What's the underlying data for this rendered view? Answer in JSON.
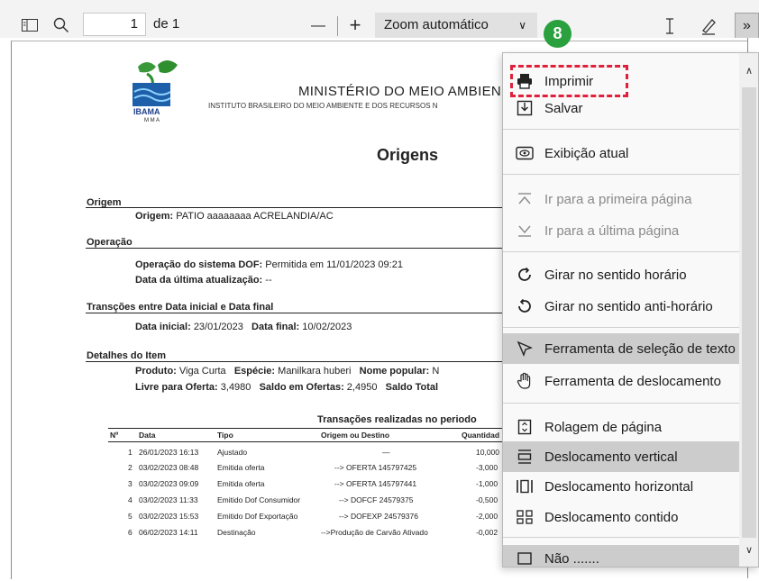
{
  "toolbar": {
    "page_number": "1",
    "page_of": "de 1",
    "zoom_minus": "—",
    "zoom_plus": "+",
    "zoom_value": "Zoom automático",
    "badge": "8",
    "more": "»"
  },
  "document": {
    "ministerio": "MINISTÉRIO DO MEIO AMBIEN",
    "logo_text_1": "IBAMA",
    "logo_text_2": "M M A",
    "instituto": "INSTITUTO BRASILEIRO DO MEIO AMBIENTE E DOS RECURSOS N",
    "title": "Origens",
    "sec_origem": "Origem",
    "origem_label": "Origem:",
    "origem_value": "PATIO aaaaaaaa ACRELANDIA/AC",
    "sec_operacao": "Operação",
    "op_label": "Operação do sistema DOF:",
    "op_value": "Permitida em 11/01/2023 09:21",
    "ult_label": "Data da última atualização:",
    "ult_value": "--",
    "sec_transicoes": "Transções entre Data inicial e Data final",
    "data_inicial_label": "Data inicial:",
    "data_inicial_value": "23/01/2023",
    "data_final_label": "Data final:",
    "data_final_value": "10/02/2023",
    "sec_detalhes": "Detalhes do Item",
    "produto_label": "Produto:",
    "produto_value": "Viga Curta",
    "especie_label": "Espécie:",
    "especie_value": "Manilkara huberi",
    "nome_pop_label": "Nome popular:",
    "nome_pop_value": "N",
    "livre_label": "Livre para Oferta:",
    "livre_value": "3,4980",
    "saldo_label": "Saldo em Ofertas:",
    "saldo_value": "2,4950",
    "saldo_total_label": "Saldo Total",
    "table_title": "Transações realizadas no periodo",
    "columns": [
      "Nº",
      "Data",
      "Tipo",
      "Origem ou Destino",
      "Quantidad"
    ],
    "rows": [
      [
        "1",
        "26/01/2023 16:13",
        "Ajustado",
        "—",
        "10,000"
      ],
      [
        "2",
        "03/02/2023 08:48",
        "Emitida oferta",
        "--> OFERTA 145797425",
        "-3,000"
      ],
      [
        "3",
        "03/02/2023 09:09",
        "Emitida oferta",
        "--> OFERTA 145797441",
        "-1,000"
      ],
      [
        "4",
        "03/02/2023 11:33",
        "Emitido Dof Consumidor",
        "--> DOFCF 24579375",
        "-0,500"
      ],
      [
        "5",
        "03/02/2023 15:53",
        "Emitido Dof Exportação",
        "--> DOFEXP 24579376",
        "-2,000"
      ],
      [
        "6",
        "06/02/2023 14:11",
        "Destinação",
        "-->Produção de Carvão Ativado",
        "-0,002"
      ]
    ]
  },
  "menu": {
    "imprimir": "Imprimir",
    "salvar": "Salvar",
    "exibicao": "Exibição atual",
    "primeira": "Ir para a primeira página",
    "ultima": "Ir para a última página",
    "girar_h": "Girar no sentido horário",
    "girar_ah": "Girar no sentido anti-horário",
    "sel_texto": "Ferramenta de seleção de texto",
    "deslocamento": "Ferramenta de deslocamento",
    "rolagem": "Rolagem de página",
    "desl_vertical": "Deslocamento vertical",
    "desl_horizontal": "Deslocamento horizontal",
    "desl_contido": "Deslocamento contido",
    "partial": "Não  ......."
  }
}
